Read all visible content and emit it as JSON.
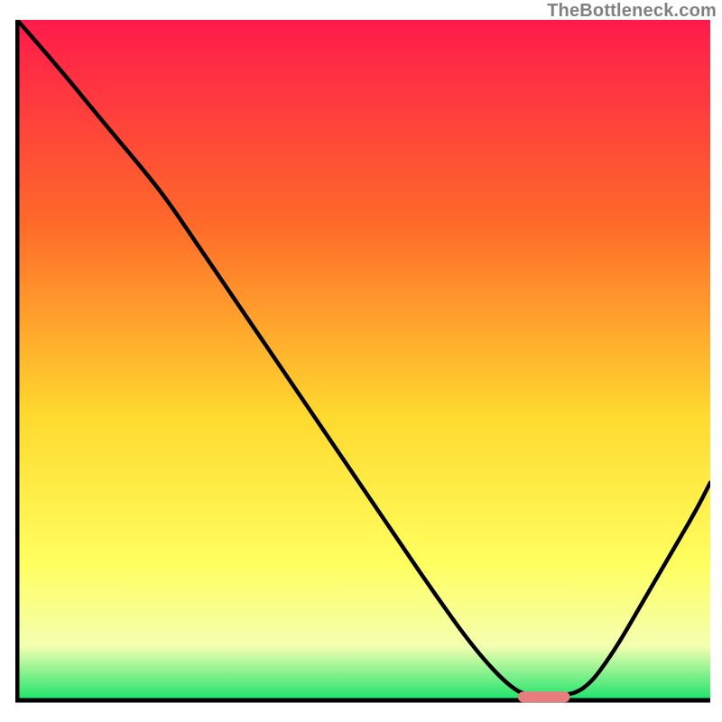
{
  "watermark": "TheBottleneck.com",
  "colors": {
    "gradient_top": "#ff1a4b",
    "gradient_mid1": "#ff6a2a",
    "gradient_mid2": "#ffd92e",
    "gradient_mid3": "#ffff60",
    "gradient_mid4": "#f4ffb0",
    "gradient_bottom": "#19e36b",
    "curve": "#000000",
    "axis": "#000000",
    "marker_fill": "#e77d7d",
    "marker_stroke": "#e77d7d"
  },
  "chart_data": {
    "type": "line",
    "title": "",
    "xlabel": "",
    "ylabel": "",
    "xlim": [
      0,
      100
    ],
    "ylim": [
      0,
      100
    ],
    "grid": false,
    "series": [
      {
        "name": "bottleneck-curve",
        "x": [
          0,
          6,
          12,
          19,
          22,
          26,
          30,
          38,
          46,
          54,
          60,
          66,
          71,
          74,
          78,
          82,
          86,
          90,
          94,
          98,
          100
        ],
        "values": [
          100,
          93,
          85.5,
          77,
          73,
          67,
          61,
          49,
          37,
          25,
          16,
          7.5,
          2,
          0.5,
          0.5,
          1.5,
          7,
          14,
          21,
          28,
          32
        ]
      }
    ],
    "marker": {
      "name": "optimal-range",
      "x_center": 76,
      "width": 7.5,
      "y": 0.5
    },
    "gradient_stops": [
      {
        "offset": 0.0,
        "color": "#ff1a4b"
      },
      {
        "offset": 0.3,
        "color": "#ff6a2a"
      },
      {
        "offset": 0.58,
        "color": "#ffd92e"
      },
      {
        "offset": 0.8,
        "color": "#ffff60"
      },
      {
        "offset": 0.92,
        "color": "#f4ffb0"
      },
      {
        "offset": 1.0,
        "color": "#19e36b"
      }
    ]
  }
}
